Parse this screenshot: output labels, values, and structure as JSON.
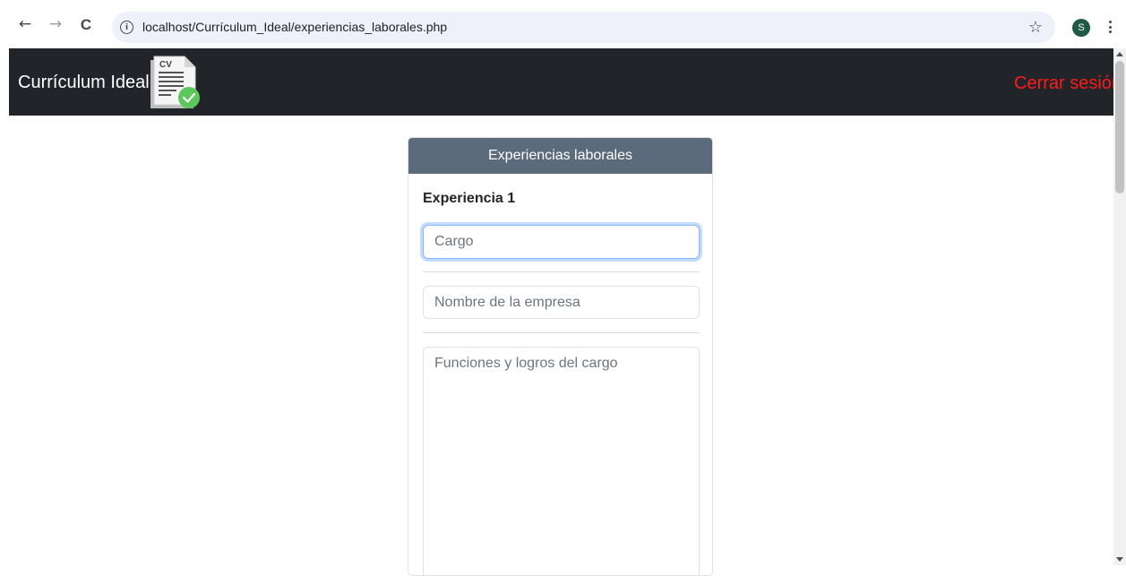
{
  "browser": {
    "url": "localhost/Currículum_Ideal/experiencias_laborales.php",
    "back_glyph": "←",
    "forward_glyph": "→",
    "reload_glyph": "C",
    "info_glyph": "i",
    "star_glyph": "☆",
    "profile_initial": "S"
  },
  "navbar": {
    "brand": "Currículum Ideal",
    "logo_text": "CV",
    "logout": "Cerrar sesión"
  },
  "card": {
    "header": "Experiencias laborales",
    "experience_title": "Experiencia 1",
    "cargo_placeholder": "Cargo",
    "cargo_value": "",
    "empresa_placeholder": "Nombre de la empresa",
    "empresa_value": "",
    "funciones_placeholder": "Funciones y logros del cargo",
    "funciones_value": ""
  },
  "colors": {
    "navbar_bg": "#212529",
    "card_header_bg": "#5c6b7c",
    "logout": "#ff1a1a",
    "focus_ring": "#86b7fe",
    "avatar_bg": "#1d5b44",
    "check_badge": "#5cc85c"
  }
}
